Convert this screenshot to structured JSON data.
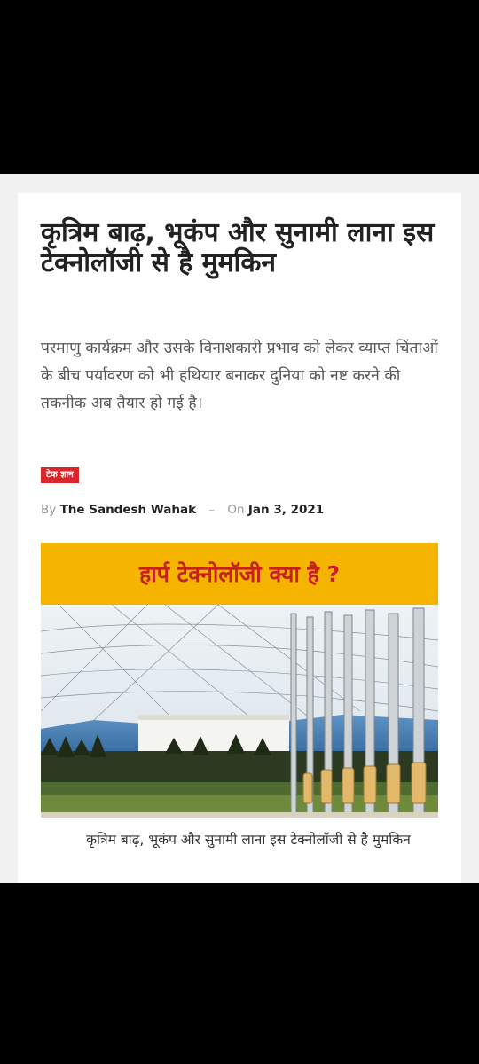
{
  "article": {
    "headline": "कृत्रिम बाढ़, भूकंप और सुनामी लाना इस टेक्नोलॉजी से है मुमकिन",
    "lead": "परमाणु कार्यक्रम और उसके विनाशकारी प्रभाव को लेकर व्याप्त चिंताओं के बीच पर्यावरण को भी हथियार बनाकर दुनिया को नष्ट करने की तकनीक अब तैयार हो गई है।",
    "category": "टेक ज्ञान",
    "by_label": "By",
    "author": "The Sandesh Wahak",
    "separator": "–",
    "on_label": "On",
    "date": "Jan 3, 2021"
  },
  "featured_image": {
    "banner_text": "हार्प टेक्नोलॉजी क्या है ?",
    "banner_color": "#f5b400",
    "banner_text_color": "#c8201d",
    "caption": "कृत्रिम बाढ़, भूकंप और सुनामी लाना इस टेक्नोलॉजी से है मुमकिन"
  }
}
